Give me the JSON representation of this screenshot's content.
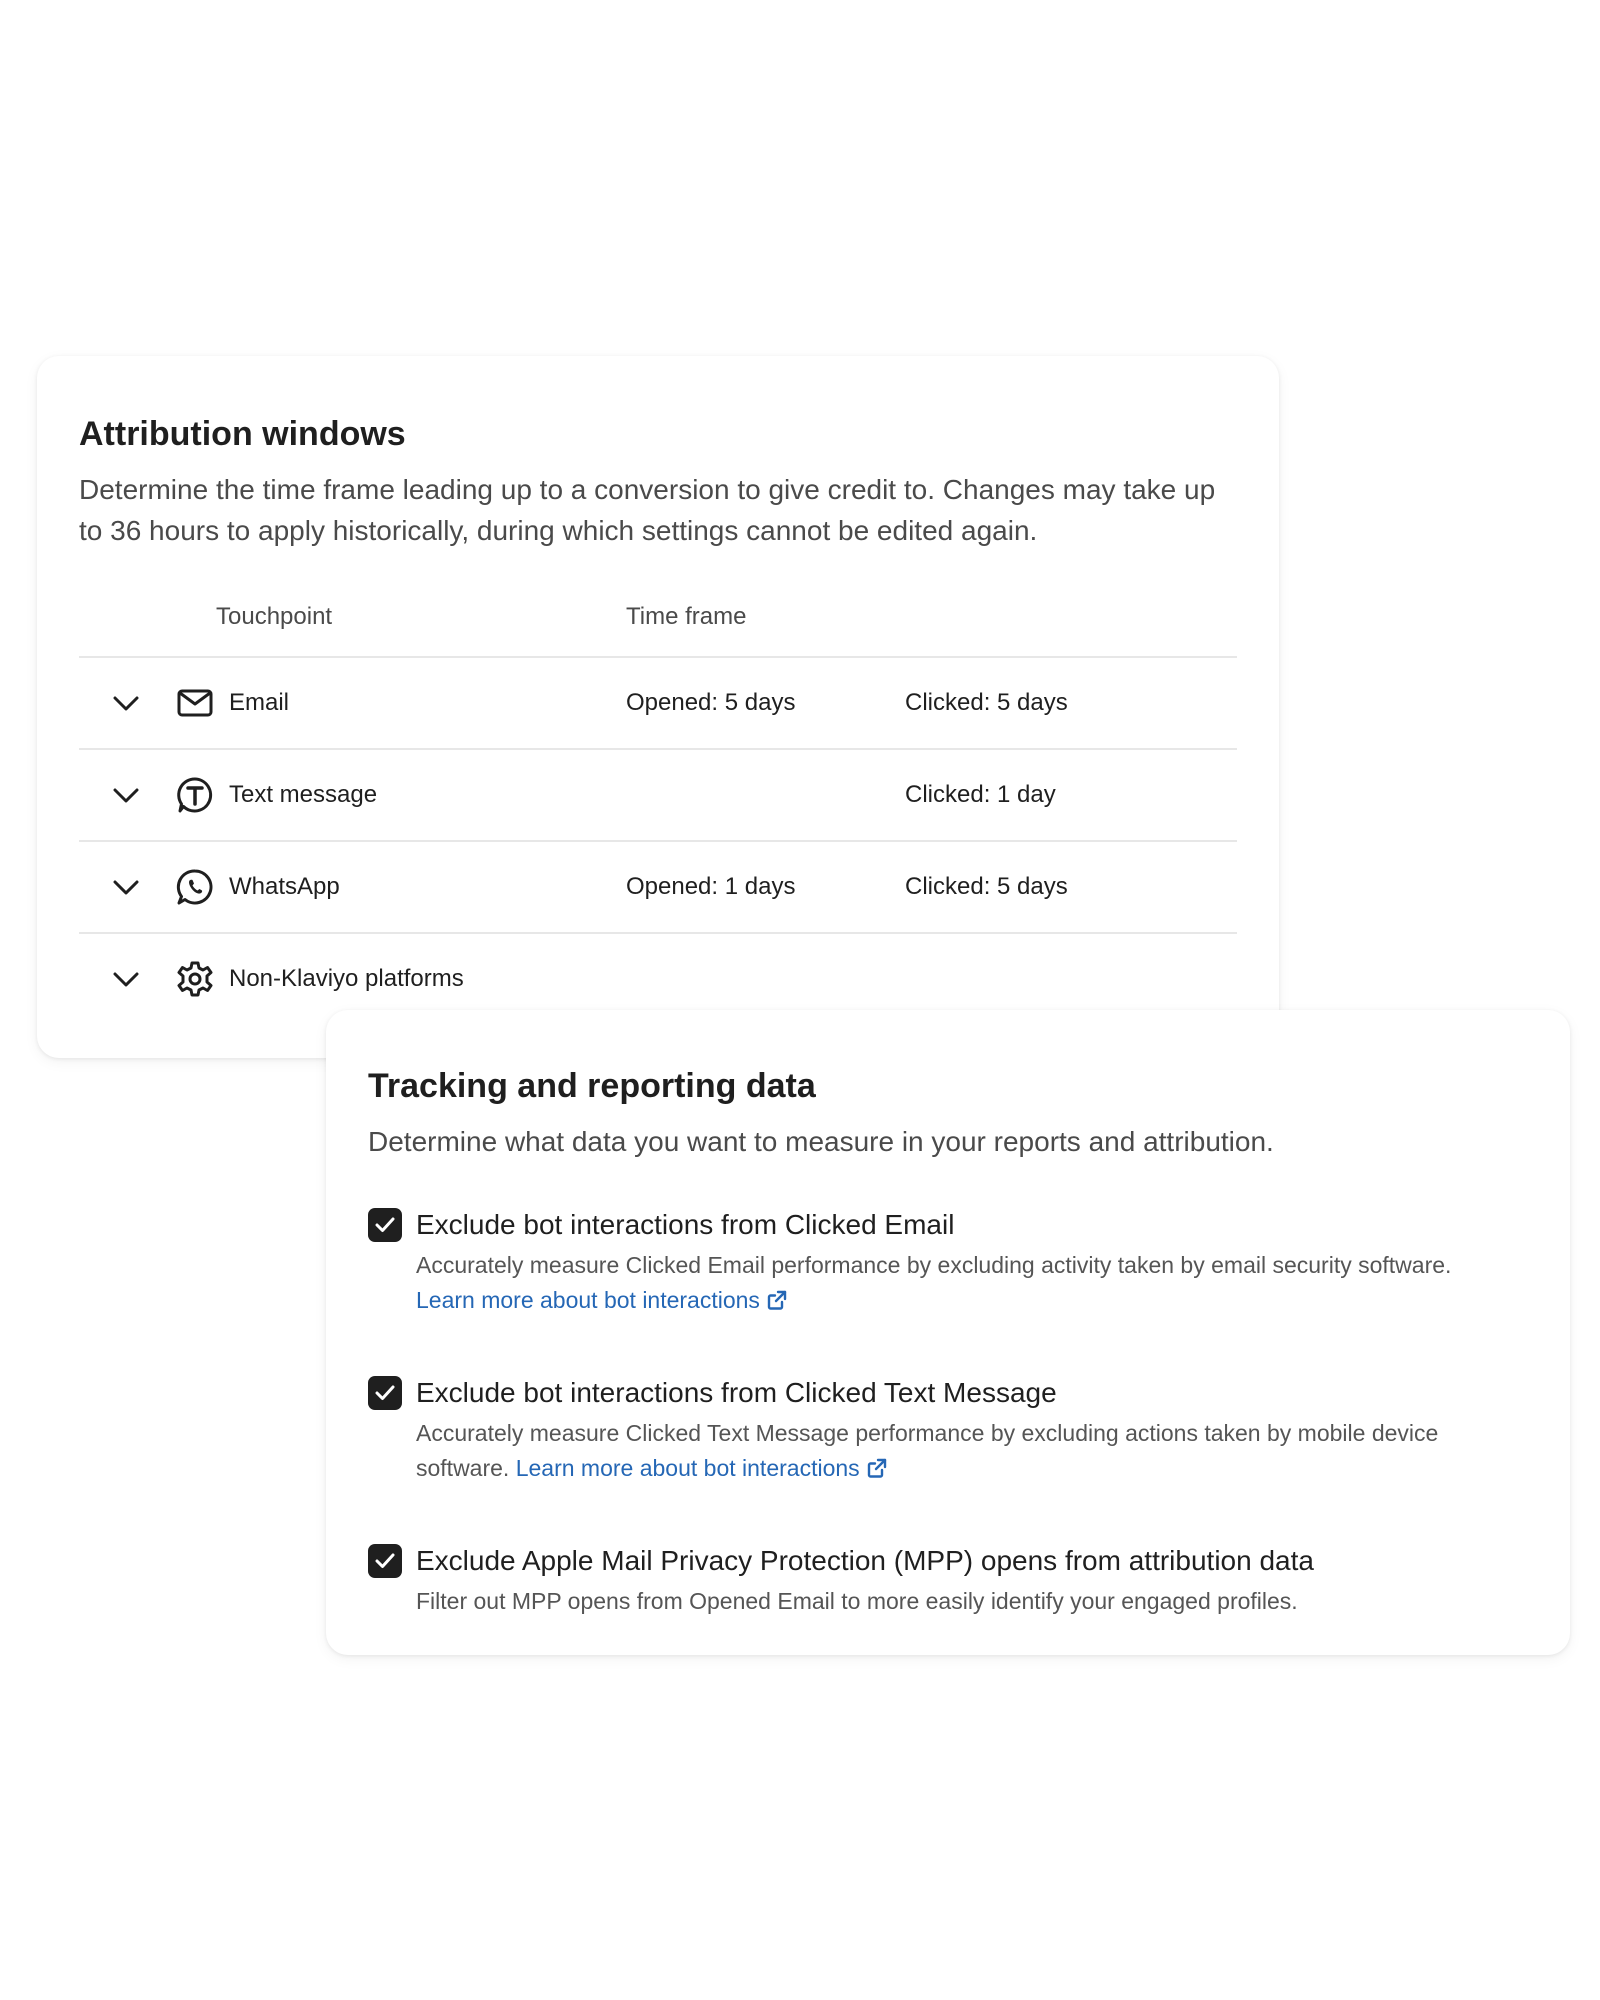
{
  "attribution": {
    "title": "Attribution windows",
    "description": "Determine the time frame leading up to a conversion to give credit to. Changes may take up to 36 hours to apply historically, during which settings cannot be edited again.",
    "columns": {
      "touchpoint": "Touchpoint",
      "time_frame": "Time frame"
    },
    "rows": [
      {
        "icon": "email-icon",
        "name": "Email",
        "opened": "Opened: 5 days",
        "clicked": "Clicked: 5 days"
      },
      {
        "icon": "text-message-icon",
        "name": "Text message",
        "opened": "",
        "clicked": "Clicked: 1 day"
      },
      {
        "icon": "whatsapp-icon",
        "name": "WhatsApp",
        "opened": "Opened: 1 days",
        "clicked": "Clicked: 5 days"
      },
      {
        "icon": "gear-icon",
        "name": "Non-Klaviyo platforms",
        "opened": "",
        "clicked": ""
      }
    ]
  },
  "tracking": {
    "title": "Tracking and reporting data",
    "description": "Determine what data you want to measure in your reports and attribution.",
    "options": [
      {
        "label": "Exclude bot interactions from Clicked Email",
        "desc": "Accurately measure Clicked Email performance by excluding activity taken by email security software.",
        "link": "Learn more about bot interactions",
        "checked": true
      },
      {
        "label": "Exclude bot interactions from Clicked Text Message",
        "desc": "Accurately measure Clicked Text Message performance by excluding actions taken by mobile device software.",
        "link": "Learn more about bot interactions",
        "checked": true
      },
      {
        "label": "Exclude Apple Mail Privacy Protection (MPP) opens from attribution data",
        "desc": "Filter out MPP opens from Opened Email to more easily identify your engaged profiles.",
        "link": "",
        "checked": true
      }
    ]
  },
  "colors": {
    "link": "#2567b5",
    "checkbox": "#1f1f1f",
    "divider": "#e7e7e7"
  }
}
